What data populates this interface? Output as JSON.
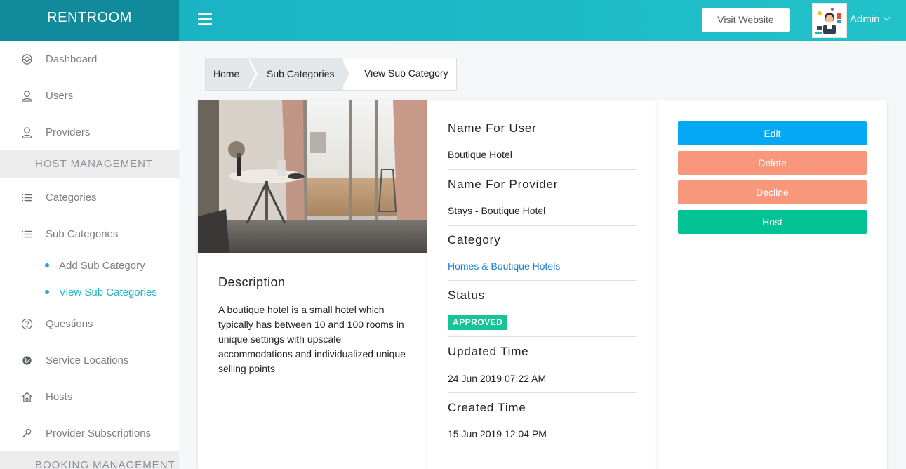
{
  "brand": "RENTROOM",
  "header": {
    "visit_website": "Visit Website",
    "user_name": "Admin"
  },
  "sidebar": {
    "items": [
      {
        "label": "Dashboard",
        "icon": "dashboard-icon"
      },
      {
        "label": "Users",
        "icon": "user-icon"
      },
      {
        "label": "Providers",
        "icon": "provider-icon"
      }
    ],
    "host_management": "HOST MANAGEMENT",
    "host_items": [
      {
        "label": "Categories",
        "icon": "list-icon"
      },
      {
        "label": "Sub Categories",
        "icon": "list-icon"
      }
    ],
    "sub_items": [
      {
        "label": "Add Sub Category"
      },
      {
        "label": "View Sub Categories",
        "active": true
      }
    ],
    "more_items": [
      {
        "label": "Questions",
        "icon": "question-icon"
      },
      {
        "label": "Service Locations",
        "icon": "globe-icon"
      },
      {
        "label": "Hosts",
        "icon": "home-icon"
      },
      {
        "label": "Provider Subscriptions",
        "icon": "key-icon"
      }
    ],
    "booking_management": "BOOKING MANAGEMENT"
  },
  "breadcrumb": {
    "home": "Home",
    "sub_categories": "Sub Categories",
    "current": "View Sub Category"
  },
  "details": {
    "description_title": "Description",
    "description_text": "A boutique hotel is a small hotel which typically has between 10 and 100 rooms in unique settings with upscale accommodations and individualized unique selling points",
    "name_for_user_label": "Name For User",
    "name_for_user": "Boutique Hotel",
    "name_for_provider_label": "Name For Provider",
    "name_for_provider": "Stays - Boutique Hotel",
    "category_label": "Category",
    "category": "Homes & Boutique Hotels",
    "status_label": "Status",
    "status": "APPROVED",
    "updated_label": "Updated Time",
    "updated": "24 Jun 2019 07:22 AM",
    "created_label": "Created Time",
    "created": "15 Jun 2019 12:04 PM"
  },
  "actions": {
    "edit": "Edit",
    "delete": "Delete",
    "decline": "Decline",
    "host": "Host"
  },
  "colors": {
    "brand_dark": "#118a9c",
    "brand": "#1ab3c4",
    "edit": "#03a9f4",
    "delete": "#f9977d",
    "decline": "#f9977d",
    "host": "#00c292",
    "approved": "#16c49a",
    "link": "#1a7fd4"
  }
}
